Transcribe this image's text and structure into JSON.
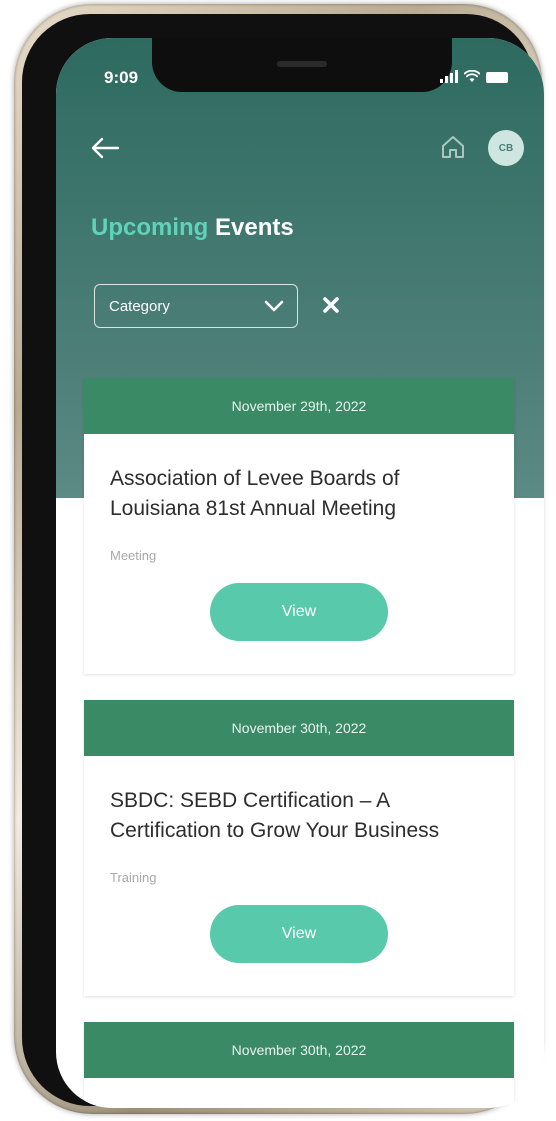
{
  "status_bar": {
    "time": "9:09"
  },
  "header": {
    "avatar_initials": "CB"
  },
  "page_title": {
    "accent": "Upcoming",
    "rest": " Events"
  },
  "filter": {
    "category_label": "Category"
  },
  "events": [
    {
      "date": "November 29th, 2022",
      "title": "Association of Levee Boards of Louisiana 81st Annual Meeting",
      "type": "Meeting",
      "button_label": "View"
    },
    {
      "date": "November 30th, 2022",
      "title": "SBDC: SEBD Certification – A Certification to Grow Your Business",
      "type": "Training",
      "button_label": "View"
    },
    {
      "date": "November 30th, 2022"
    }
  ],
  "colors": {
    "accent": "#5fd3b8",
    "date_band": "#3a8a66",
    "view_button": "#58c9aa",
    "header_bg": "#2e6a60"
  }
}
